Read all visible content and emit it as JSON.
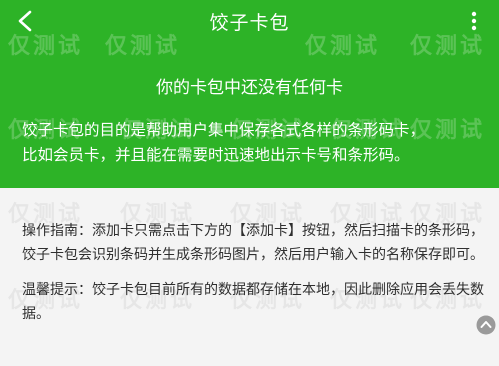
{
  "header": {
    "title": "饺子卡包",
    "back_icon": "chevron-left-icon",
    "menu_icon": "more-vertical-icon",
    "empty_state": "你的卡包中还没有任何卡",
    "intro_line1": "饺子卡包的目的是帮助用户集中保存各式各样的条形码卡，",
    "intro_line2": "比如会员卡，并且能在需要时迅速地出示卡号和条形码。",
    "background": "#2db327"
  },
  "guide": {
    "text": "操作指南：添加卡只需点击下方的【添加卡】按钮，然后扫描卡的条形码，饺子卡包会识别条码并生成条形码图片，然后用户输入卡的名称保存即可。"
  },
  "tip": {
    "text": "温馨提示：饺子卡包目前所有的数据都存储在本地，因此删除应用会丢失数据。"
  },
  "watermark": {
    "text": "仅测试"
  }
}
